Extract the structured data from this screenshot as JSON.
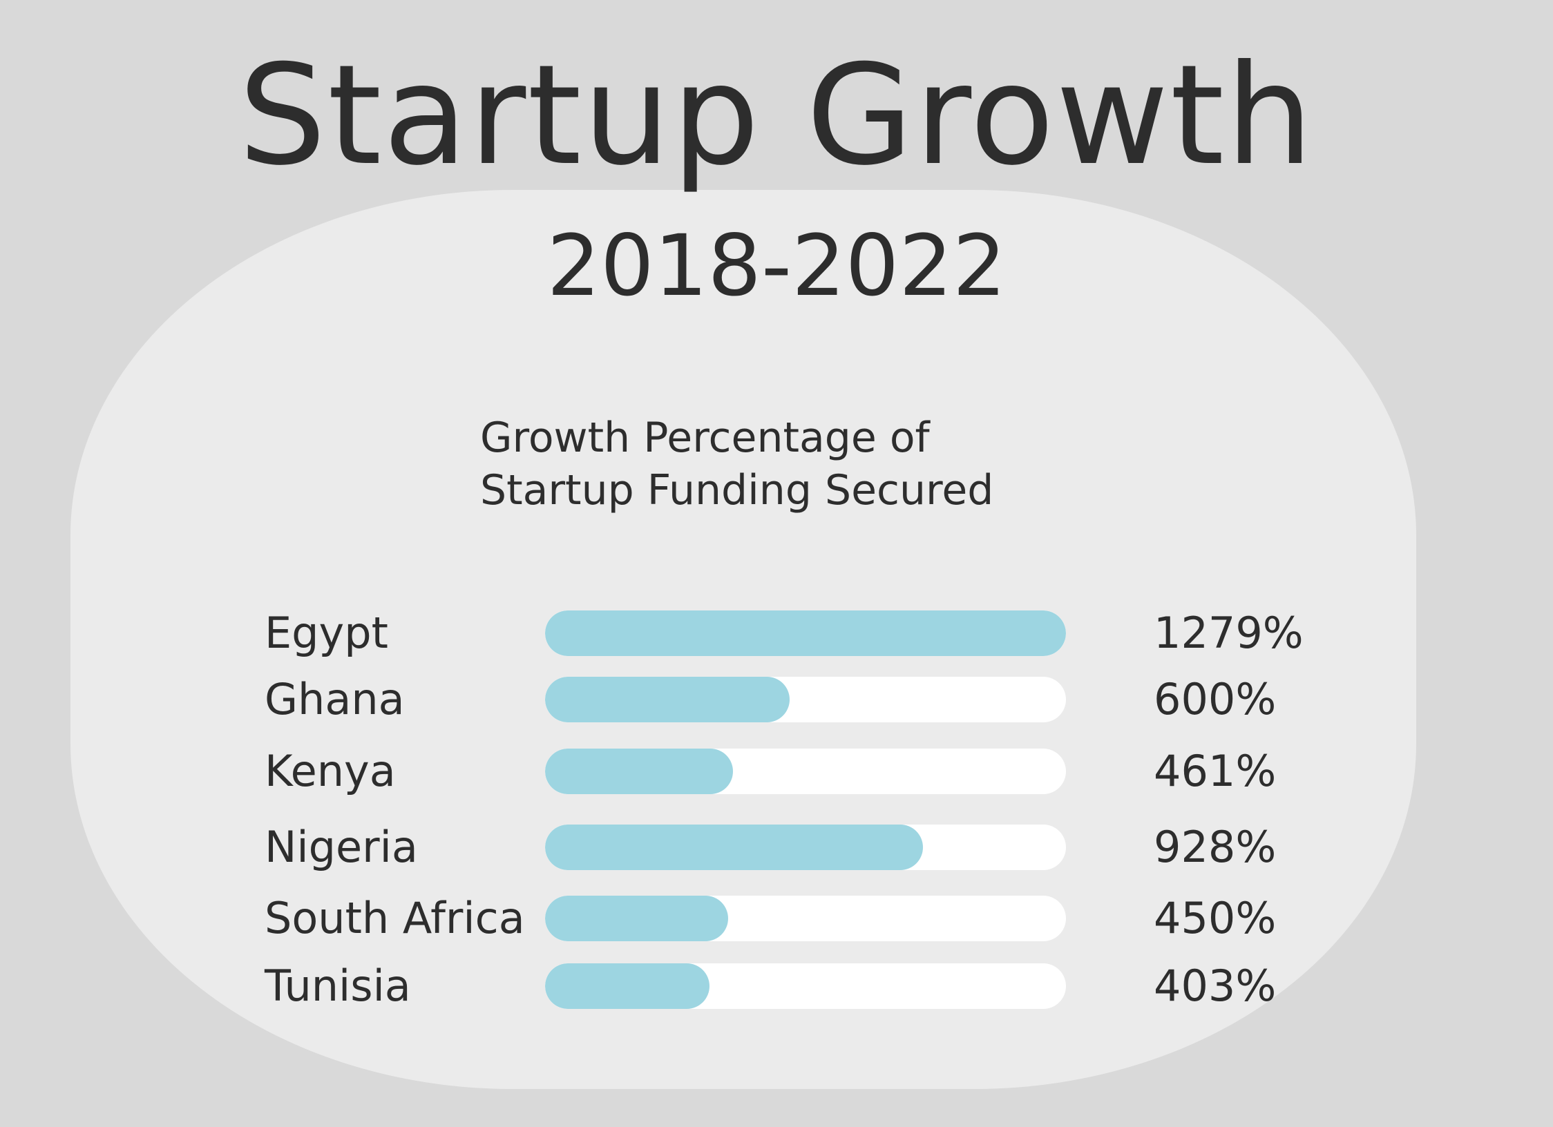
{
  "header": {
    "title": "Startup Growth",
    "subtitle": "2018-2022"
  },
  "chart_data": {
    "type": "bar",
    "orientation": "horizontal",
    "title_lines": [
      "Growth Percentage of",
      "Startup Funding Secured"
    ],
    "categories": [
      "Egypt",
      "Ghana",
      "Kenya",
      "Nigeria",
      "South Africa",
      "Tunisia"
    ],
    "values": [
      1279,
      600,
      461,
      928,
      450,
      403
    ],
    "value_labels": [
      "1279%",
      "600%",
      "461%",
      "928%",
      "450%",
      "403%"
    ],
    "xlim": [
      0,
      1279
    ],
    "grid": false,
    "colors": {
      "bar_fill": "#9dd5e1",
      "bar_track": "#ffffff"
    }
  }
}
